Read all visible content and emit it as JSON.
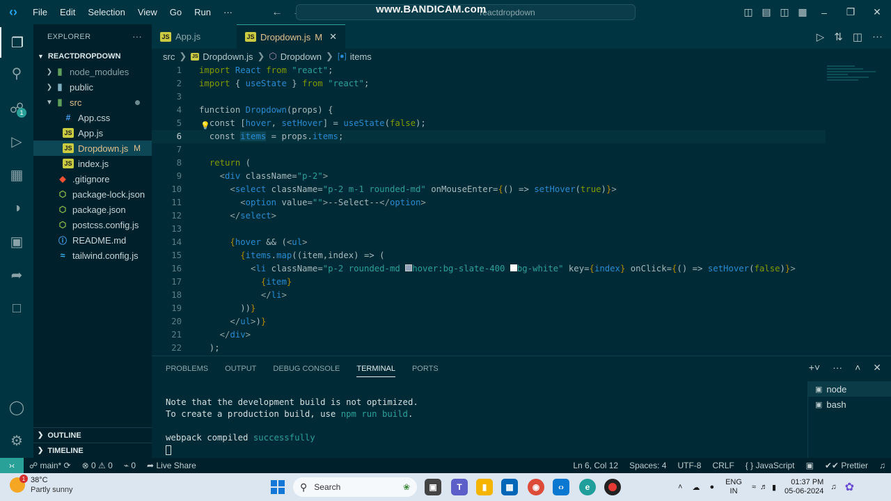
{
  "titlebar": {
    "menu": [
      "File",
      "Edit",
      "Selection",
      "View",
      "Go",
      "Run",
      "···"
    ],
    "command_center": "reactdropdown",
    "watermark": "www.BANDICAM.com"
  },
  "sidebar": {
    "title": "EXPLORER",
    "more": "···",
    "project": "REACTDROPDOWN",
    "items": [
      {
        "label": "node_modules",
        "icon": "folder-icon"
      },
      {
        "label": "public",
        "icon": "folder-icon"
      },
      {
        "label": "src",
        "icon": "folder-icon"
      },
      {
        "label": "App.css",
        "icon": "css-icon"
      },
      {
        "label": "App.js",
        "icon": "js-icon"
      },
      {
        "label": "Dropdown.js",
        "icon": "js-icon",
        "status": "M"
      },
      {
        "label": "index.js",
        "icon": "js-icon"
      },
      {
        "label": ".gitignore",
        "icon": "git-icon"
      },
      {
        "label": "package-lock.json",
        "icon": "json-icon"
      },
      {
        "label": "package.json",
        "icon": "json-icon"
      },
      {
        "label": "postcss.config.js",
        "icon": "json-icon"
      },
      {
        "label": "README.md",
        "icon": "md-icon"
      },
      {
        "label": "tailwind.config.js",
        "icon": "tailwind-icon"
      }
    ],
    "outline": "OUTLINE",
    "timeline": "TIMELINE"
  },
  "tabs": [
    {
      "label": "App.js"
    },
    {
      "label": "Dropdown.js",
      "flag": "M",
      "close": "✕"
    }
  ],
  "breadcrumb": {
    "a": "src",
    "b": "Dropdown.js",
    "c": "Dropdown",
    "d": "items"
  },
  "code": {
    "lines": [
      "1",
      "2",
      "3",
      "4",
      "5",
      "6",
      "7",
      "8",
      "9",
      "10",
      "11",
      "12",
      "13",
      "14",
      "15",
      "16",
      "17",
      "18",
      "19",
      "20",
      "21",
      "22"
    ]
  },
  "panel": {
    "tabs": [
      "PROBLEMS",
      "OUTPUT",
      "DEBUG CONSOLE",
      "TERMINAL",
      "PORTS"
    ],
    "terminal": {
      "l1": "Note that the development build is not optimized.",
      "l2a": "To create a production build, use ",
      "l2b": "npm run build",
      "l2c": ".",
      "l3a": "webpack compiled ",
      "l3b": "successfully"
    },
    "terminals": [
      "node",
      "bash"
    ]
  },
  "statusbar": {
    "branch": "main*",
    "errors": "0",
    "warnings": "0",
    "ports": "0",
    "liveshare": "Live Share",
    "position": "Ln 6, Col 12",
    "spaces": "Spaces: 4",
    "encoding": "UTF-8",
    "eol": "CRLF",
    "language": "{ } JavaScript",
    "prettier": "Prettier"
  },
  "taskbar": {
    "temp": "38°C",
    "weather": "Partly sunny",
    "weather_badge": "1",
    "search": "Search",
    "lang1": "ENG",
    "lang2": "IN",
    "time": "01:37 PM",
    "date": "05-06-2024"
  }
}
